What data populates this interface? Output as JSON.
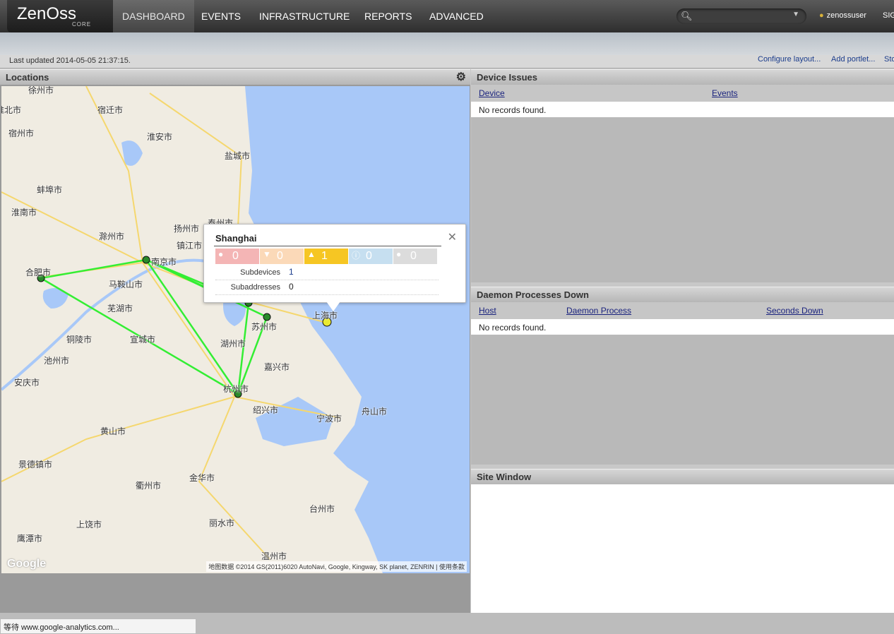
{
  "brand": {
    "word": "ZenOss",
    "tm": "™",
    "sub": "CORE"
  },
  "nav": {
    "dashboard": "DASHBOARD",
    "events": "EVENTS",
    "infrastructure": "INFRASTRUCTURE",
    "reports": "REPORTS",
    "advanced": "ADVANCED"
  },
  "search": {
    "icon": "search-icon",
    "dropdown_icon": "chevron-down-icon",
    "value": ""
  },
  "user": {
    "name": "zenossuser",
    "signout": "SIG"
  },
  "status": {
    "last_updated": "Last updated 2014-05-05 21:37:15.",
    "configure_layout": "Configure layout...",
    "add_portlet": "Add portlet...",
    "stop": "Sto"
  },
  "locations": {
    "title": "Locations",
    "settings_icon": "gear-icon",
    "cities": {
      "xuzhou": "徐州市",
      "huaibei": "淮北市",
      "suqian": "宿迁市",
      "suzhou_ah": "宿州市",
      "huaian": "淮安市",
      "yancheng": "盐城市",
      "bengbu": "蚌埠市",
      "huainan": "淮南市",
      "chuzhou": "滁州市",
      "yangzhou": "扬州市",
      "taizhou_js": "泰州市",
      "zhenjiang": "镇江市",
      "nanjing": "南京市",
      "hefei": "合肥市",
      "maanshan": "马鞍山市",
      "wuhu": "芜湖市",
      "suzhou": "苏州市",
      "shanghai": "上海市",
      "tongling": "铜陵市",
      "xuancheng": "宣城市",
      "huzhou": "湖州市",
      "chizhou": "池州市",
      "jiaxing": "嘉兴市",
      "anqing": "安庆市",
      "hangzhou": "杭州市",
      "shaoxing": "绍兴市",
      "ningbo": "宁波市",
      "zhoushan": "舟山市",
      "huangshan": "黄山市",
      "jingdezhen": "景德镇市",
      "quzhou": "衢州市",
      "jinhua": "金华市",
      "taizhou": "台州市",
      "shangrao": "上饶市",
      "lishui": "丽水市",
      "yingtan": "鹰潭市",
      "wenzhou": "温州市"
    },
    "attribution": "地图数据 ©2014 GS(2011)6020 AutoNavi, Google, Kingway, SK planet, ZENRIN",
    "terms": "使用条款",
    "google": "Google"
  },
  "popup": {
    "title": "Shanghai",
    "close_icon": "close-icon",
    "severities": [
      {
        "icon": "critical-icon",
        "count": "0",
        "color": "#f4b5b5"
      },
      {
        "icon": "error-icon",
        "count": "0",
        "color": "#fbd9b8"
      },
      {
        "icon": "warning-icon",
        "count": "1",
        "color": "#f6c623"
      },
      {
        "icon": "info-icon",
        "count": "0",
        "color": "#c6dff0"
      },
      {
        "icon": "debug-icon",
        "count": "0",
        "color": "#dcdcdc"
      }
    ],
    "subdevices_label": "Subdevices",
    "subdevices_value": "1",
    "subaddresses_label": "Subaddresses",
    "subaddresses_value": "0"
  },
  "device_issues": {
    "title": "Device Issues",
    "col_device": "Device",
    "col_events": "Events",
    "empty": "No records found."
  },
  "daemon": {
    "title": "Daemon Processes Down",
    "col_host": "Host",
    "col_process": "Daemon Process",
    "col_seconds": "Seconds Down",
    "empty": "No records found."
  },
  "site_window": {
    "title": "Site Window"
  },
  "browser_status": "等待 www.google-analytics.com..."
}
